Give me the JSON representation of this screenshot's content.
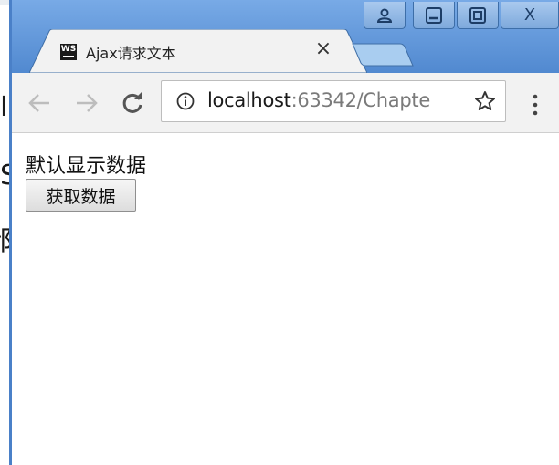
{
  "background_glyphs": [
    "I",
    "S",
    "邰"
  ],
  "window": {
    "caption_buttons": {
      "user_icon": "user-icon",
      "minimize_icon": "minimize-icon",
      "maximize_icon": "maximize-icon",
      "close_label": "X"
    }
  },
  "tab": {
    "favicon_text": "WS",
    "title": "Ajax请求文本",
    "close_label": "×"
  },
  "toolbar": {
    "back_icon": "arrow-left-icon",
    "forward_icon": "arrow-right-icon",
    "reload_icon": "reload-icon",
    "url_host": "localhost",
    "url_rest": ":63342/Chapte",
    "star_icon": "star-icon",
    "menu_icon": "kebab-menu-icon"
  },
  "page": {
    "default_text": "默认显示数据",
    "fetch_button_label": "获取数据"
  },
  "colors": {
    "titlebar": "#5b93d6",
    "toolbar": "#f2f2f2",
    "content": "#ffffff"
  }
}
